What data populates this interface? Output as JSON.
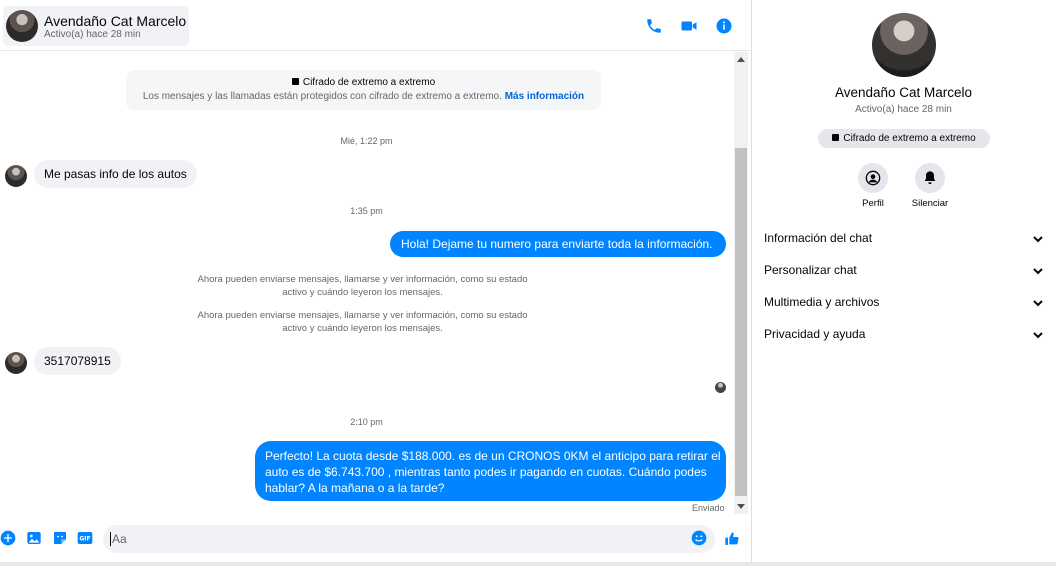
{
  "header": {
    "contact_name": "Avendaño Cat Marcelo",
    "contact_status": "Activo(a) hace 28 min",
    "icons": [
      "phone-icon",
      "video-camera-icon",
      "info-icon"
    ]
  },
  "conversation": {
    "e2e_notice": {
      "title": "Cifrado de extremo a extremo",
      "text": "Los mensajes y las llamadas están protegidos con cifrado de extremo a extremo.",
      "link": "Más información"
    },
    "timestamps": [
      "Mié, 1:22 pm",
      "1:35 pm",
      "2:10 pm"
    ],
    "messages": [
      {
        "from": "contact",
        "text": "Me pasas info de los autos"
      },
      {
        "from": "me",
        "text": "Hola! Dejame tu numero  para enviarte toda la información."
      },
      {
        "from": "contact",
        "text": "3517078915"
      },
      {
        "from": "me",
        "lines": [
          "Perfecto! La cuota desde $188.000. es de un CRONOS 0KM el anticipo para retirar el",
          "auto es de $6.743.700 , mientras tanto podes ir pagando en cuotas. Cuándo podes",
          "hablar? A la mañana o a la tarde?"
        ]
      }
    ],
    "system_messages": [
      {
        "line1": "Ahora pueden enviarse mensajes, llamarse y ver información, como su estado",
        "line2": "activo y cuándo leyeron los mensajes."
      },
      {
        "line1": "Ahora pueden enviarse mensajes, llamarse y ver información, como su estado",
        "line2": "activo y cuándo leyeron los mensajes."
      }
    ],
    "sent_status": "Enviado"
  },
  "composer": {
    "placeholder": "Aa",
    "icons": [
      "plus-icon",
      "photo-icon",
      "sticker-icon",
      "gif-icon",
      "emoji-icon",
      "thumbs-up-icon"
    ],
    "gif_label": "GIF"
  },
  "info_panel": {
    "name": "Avendaño Cat Marcelo",
    "status": "Activo(a) hace 28 min",
    "e2e_badge": "Cifrado de extremo a extremo",
    "actions": [
      {
        "label": "Perfil",
        "icon": "profile-icon"
      },
      {
        "label": "Silenciar",
        "icon": "bell-icon"
      }
    ],
    "sections": [
      "Información del chat",
      "Personalizar chat",
      "Multimedia y archivos",
      "Privacidad y ayuda"
    ]
  },
  "colors": {
    "accent": "#0084ff",
    "incoming_bubble": "#f0f2f5",
    "secondary_text": "#65676b",
    "link": "#0064d1"
  }
}
